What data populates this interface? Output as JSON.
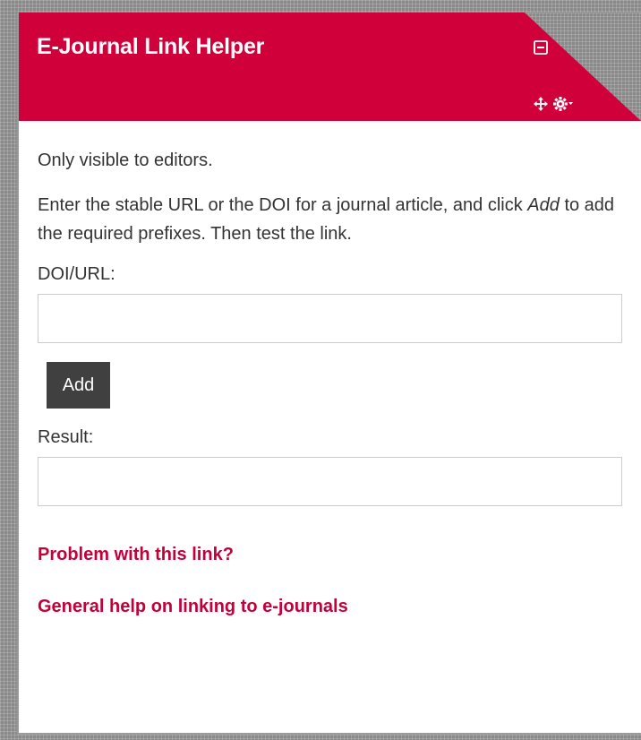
{
  "block": {
    "title": "E-Journal Link Helper",
    "icons": {
      "collapse": "collapse-icon",
      "move": "move-icon",
      "settings": "gear-icon"
    },
    "visibility_note": "Only visible to editors.",
    "instructions": {
      "before": "Enter the stable URL or the DOI for a journal article, and click ",
      "emphasis": "Add",
      "after": " to add the required prefixes. Then test the link."
    },
    "doi_label": "DOI/URL:",
    "doi_value": "",
    "add_label": "Add",
    "result_label": "Result:",
    "result_value": "",
    "links": {
      "problem": "Problem with this link?",
      "help": "General help on linking to e-journals"
    }
  },
  "colors": {
    "header_bg": "#d0003a",
    "link": "#c4003a",
    "button_bg": "#404040",
    "text": "#333333"
  }
}
